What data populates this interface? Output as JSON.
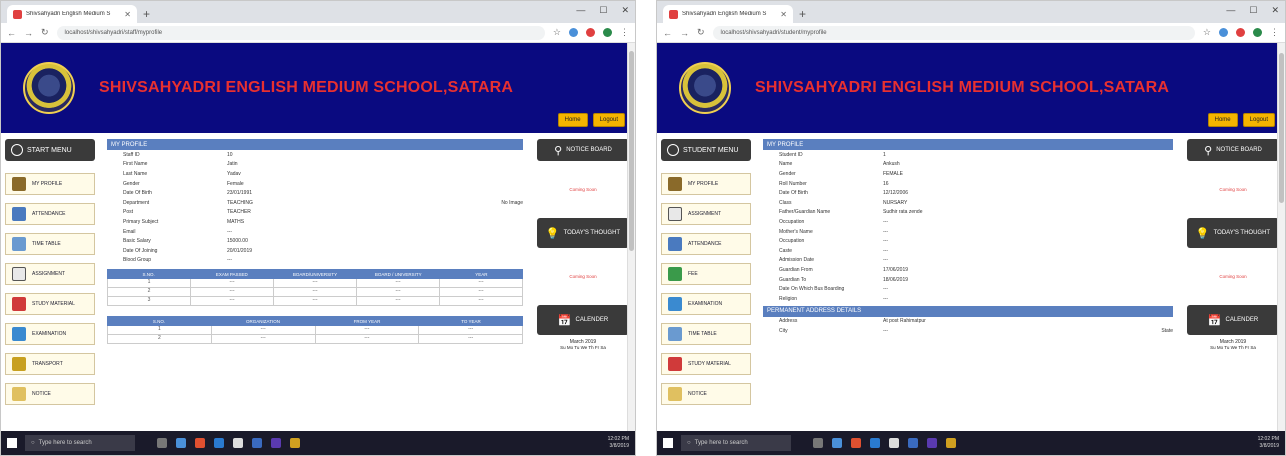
{
  "left_window": {
    "tab_title": "Shivsahyadri English Medium S",
    "url": "localhost/shivsahyadri/staff/myprofile",
    "school_name": "SHIVSAHYADRI ENGLISH MEDIUM SCHOOL,SATARA",
    "header_buttons": [
      "Home",
      "Logout"
    ],
    "start_menu": "START MENU",
    "menu": [
      "MY PROFILE",
      "ATTENDANCE",
      "TIME TABLE",
      "ASSIGNMENT",
      "STUDY MATERIAL",
      "EXAMINATION",
      "TRANSPORT",
      "NOTICE"
    ],
    "panel_title": "MY PROFILE",
    "profile": [
      {
        "k": "Staff ID",
        "v": "10",
        "x": ""
      },
      {
        "k": "First Name",
        "v": "Jatin",
        "x": ""
      },
      {
        "k": "Last Name",
        "v": "Yadav",
        "x": ""
      },
      {
        "k": "Gender",
        "v": "Female",
        "x": ""
      },
      {
        "k": "Date Of Birth",
        "v": "23/01/1991",
        "x": ""
      },
      {
        "k": "Department",
        "v": "TEACHING",
        "x": "No Image"
      },
      {
        "k": "Post",
        "v": "TEACHER",
        "x": ""
      },
      {
        "k": "Primary Subject",
        "v": "MATHS",
        "x": ""
      },
      {
        "k": "Email",
        "v": "---",
        "x": ""
      },
      {
        "k": "Basic Salary",
        "v": "15000.00",
        "x": ""
      },
      {
        "k": "Date Of Joining",
        "v": "20/01/2019",
        "x": ""
      },
      {
        "k": "Blood Group",
        "v": "---",
        "x": ""
      }
    ],
    "edu_table": {
      "headers": [
        "S.NO.",
        "EXAM PASSED",
        "BOARD/UNIVERSITY",
        "BOARD / UNIVERSITY",
        "YEAR"
      ],
      "rows": [
        [
          "1",
          "---",
          "---",
          "---",
          "---"
        ],
        [
          "2",
          "---",
          "---",
          "---",
          "---"
        ],
        [
          "3",
          "---",
          "---",
          "---",
          "---"
        ]
      ]
    },
    "exp_table": {
      "headers": [
        "S.NO.",
        "ORGANIZATION",
        "FROM YEAR",
        "TO YEAR"
      ],
      "rows": [
        [
          "1",
          "---",
          "---",
          "---"
        ],
        [
          "2",
          "---",
          "---",
          "---"
        ]
      ]
    },
    "right": {
      "notice_btn": "NOTICE BOARD",
      "link1": "Coming Soon",
      "thought_btn": "TODAY'S THOUGHT",
      "link2": "Coming Soon",
      "calendar_btn": "CALENDER",
      "calendar_month": "March 2019",
      "calendar_days": "Su Mo Tu We Th Fr Sa"
    }
  },
  "right_window": {
    "tab_title": "Shivsahyadri English Medium S",
    "url": "localhost/shivsahyadri/student/myprofile",
    "school_name": "SHIVSAHYADRI ENGLISH MEDIUM SCHOOL,SATARA",
    "header_buttons": [
      "Home",
      "Logout"
    ],
    "start_menu": "STUDENT MENU",
    "menu": [
      "MY PROFILE",
      "ASSIGNMENT",
      "ATTENDANCE",
      "FEE",
      "EXAMINATION",
      "TIME TABLE",
      "STUDY MATERIAL",
      "NOTICE"
    ],
    "panel_title": "MY PROFILE",
    "profile": [
      {
        "k": "Student ID",
        "v": "1",
        "x": ""
      },
      {
        "k": "Name",
        "v": "Ankush",
        "x": ""
      },
      {
        "k": "Gender",
        "v": "FEMALE",
        "x": ""
      },
      {
        "k": "Roll Number",
        "v": "16",
        "x": ""
      },
      {
        "k": "Date Of Birth",
        "v": "12/12/2006",
        "x": ""
      },
      {
        "k": "Class",
        "v": "NURSARY",
        "x": ""
      },
      {
        "k": "Father/Guardian Name",
        "v": "Sudhir rata zende",
        "x": ""
      },
      {
        "k": "Occupation",
        "v": "---",
        "x": ""
      },
      {
        "k": "Mother's Name",
        "v": "---",
        "x": ""
      },
      {
        "k": "Occupation",
        "v": "---",
        "x": ""
      },
      {
        "k": "Caste",
        "v": "---",
        "x": ""
      },
      {
        "k": "Admission Date",
        "v": "---",
        "x": ""
      },
      {
        "k": "Guardian From",
        "v": "17/06/2019",
        "x": ""
      },
      {
        "k": "Guardian To",
        "v": "18/06/2019",
        "x": ""
      },
      {
        "k": "Date On Which Bus Boarding",
        "v": "---",
        "x": ""
      },
      {
        "k": "Religion",
        "v": "---",
        "x": ""
      }
    ],
    "section2_title": "PERMANENT ADDRESS DETAILS",
    "address": [
      {
        "k": "Address",
        "v": "At post Rahimatpur",
        "x": ""
      },
      {
        "k": "City",
        "v": "---",
        "x": "State"
      }
    ],
    "right": {
      "notice_btn": "NOTICE BOARD",
      "link1": "Coming Soon",
      "thought_btn": "TODAY'S THOUGHT",
      "link2": "Coming Soon",
      "calendar_btn": "CALENDER",
      "calendar_month": "March 2019",
      "calendar_days": "Su Mo Tu We Th Fr Sa"
    }
  },
  "taskbar": {
    "search_placeholder": "Type here to search",
    "time": "12:02 PM",
    "date": "3/8/2019"
  },
  "colors": {
    "banner": "#0a0a80",
    "school_name": "#e83030",
    "panel_head": "#5a7fbf",
    "header_button": "#f4b400",
    "right_button": "#3a3a3a"
  }
}
